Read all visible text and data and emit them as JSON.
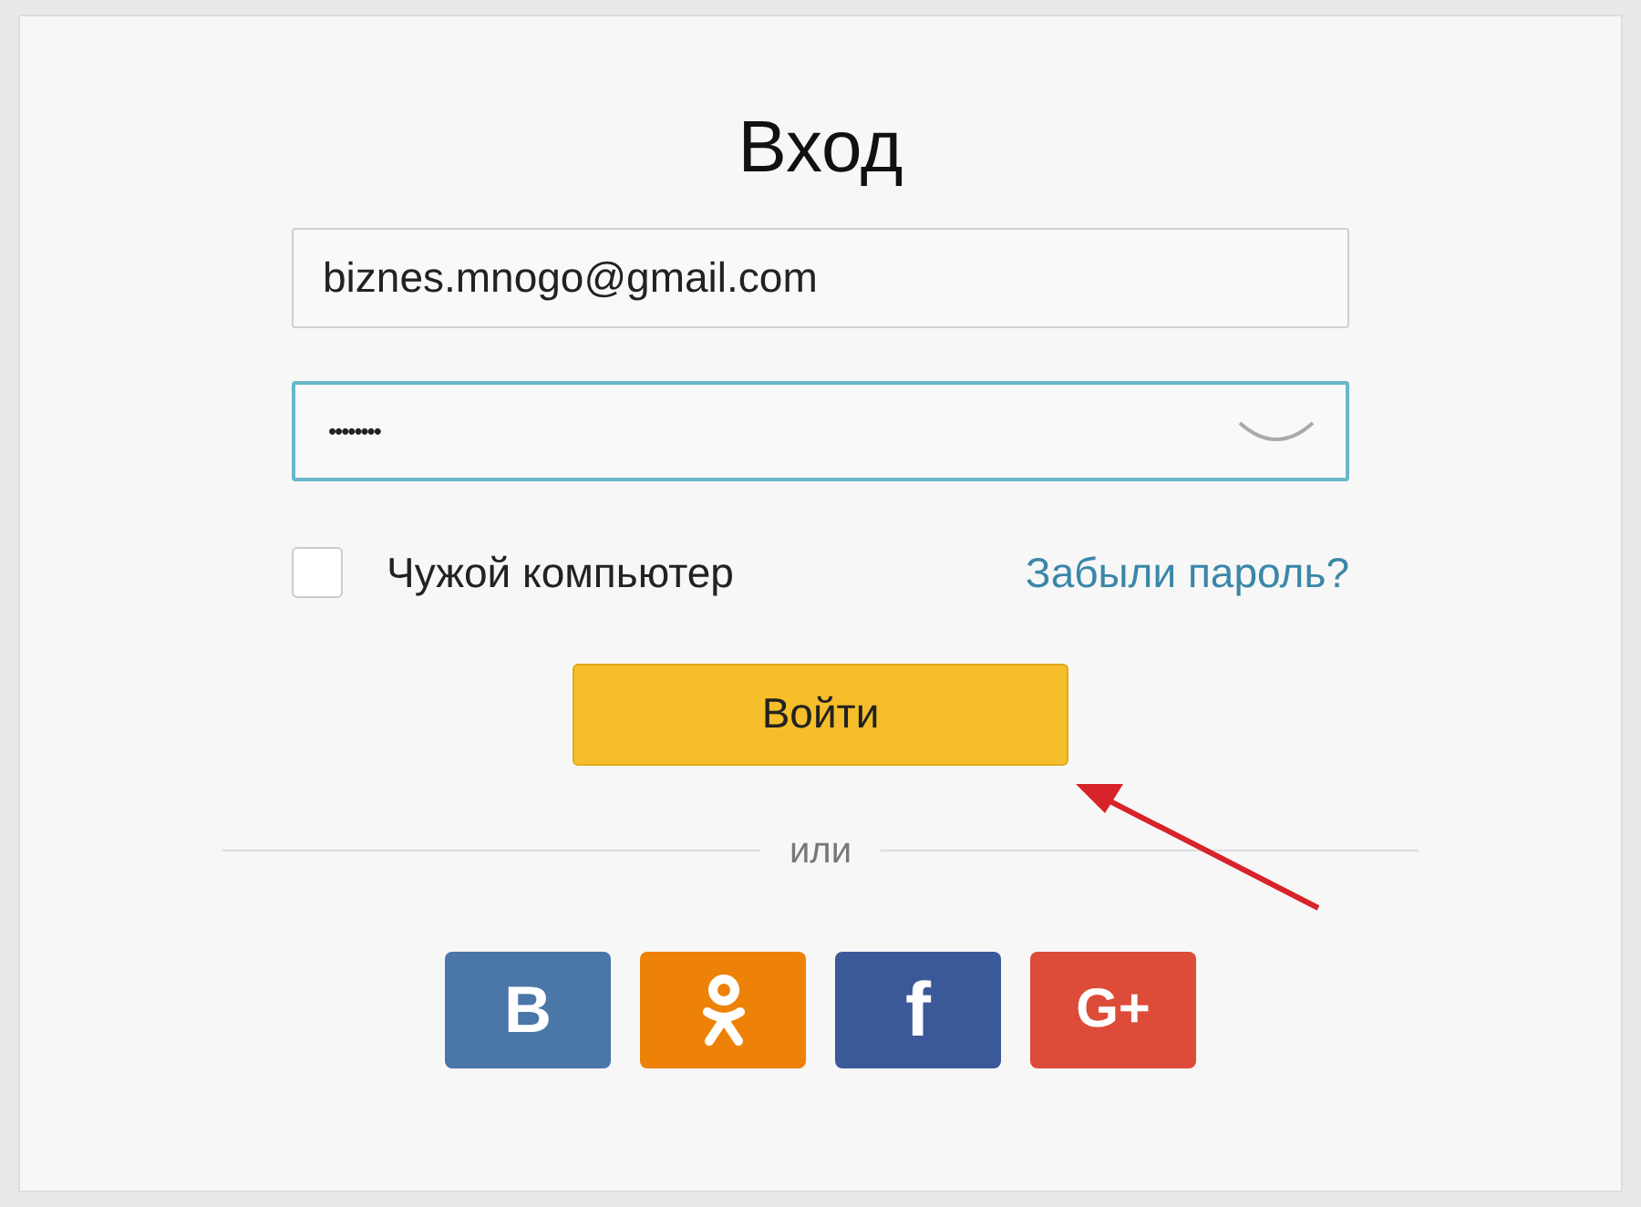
{
  "title": "Вход",
  "login": {
    "value": "biznes.mnogo@gmail.com",
    "focused": false
  },
  "password": {
    "value": "••••••••",
    "focused": true
  },
  "remember": {
    "label": "Чужой компьютер",
    "checked": false
  },
  "forgot_link": "Забыли пароль?",
  "submit": "Войти",
  "divider": "или",
  "social": [
    {
      "kind": "vk",
      "label": "В",
      "color": "#4a76a8"
    },
    {
      "kind": "ok",
      "color": "#ee8208"
    },
    {
      "kind": "fb",
      "label": "f",
      "color": "#3b5998"
    },
    {
      "kind": "gplus",
      "label": "G+",
      "color": "#dd4b39"
    }
  ]
}
